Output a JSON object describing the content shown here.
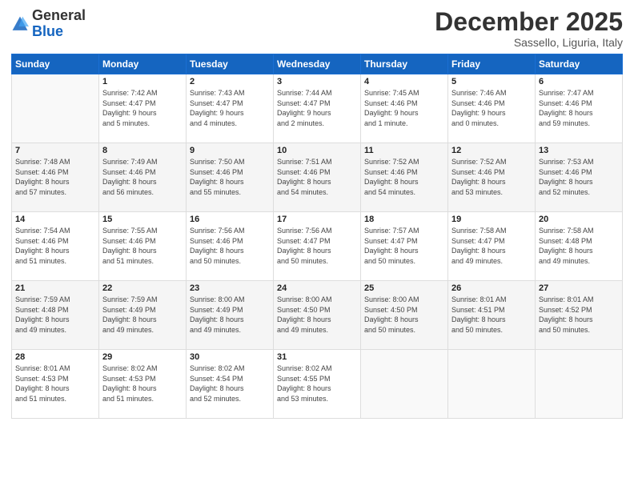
{
  "header": {
    "logo_general": "General",
    "logo_blue": "Blue",
    "month_title": "December 2025",
    "location": "Sassello, Liguria, Italy"
  },
  "weekdays": [
    "Sunday",
    "Monday",
    "Tuesday",
    "Wednesday",
    "Thursday",
    "Friday",
    "Saturday"
  ],
  "weeks": [
    [
      {
        "day": "",
        "info": ""
      },
      {
        "day": "1",
        "info": "Sunrise: 7:42 AM\nSunset: 4:47 PM\nDaylight: 9 hours\nand 5 minutes."
      },
      {
        "day": "2",
        "info": "Sunrise: 7:43 AM\nSunset: 4:47 PM\nDaylight: 9 hours\nand 4 minutes."
      },
      {
        "day": "3",
        "info": "Sunrise: 7:44 AM\nSunset: 4:47 PM\nDaylight: 9 hours\nand 2 minutes."
      },
      {
        "day": "4",
        "info": "Sunrise: 7:45 AM\nSunset: 4:46 PM\nDaylight: 9 hours\nand 1 minute."
      },
      {
        "day": "5",
        "info": "Sunrise: 7:46 AM\nSunset: 4:46 PM\nDaylight: 9 hours\nand 0 minutes."
      },
      {
        "day": "6",
        "info": "Sunrise: 7:47 AM\nSunset: 4:46 PM\nDaylight: 8 hours\nand 59 minutes."
      }
    ],
    [
      {
        "day": "7",
        "info": "Sunrise: 7:48 AM\nSunset: 4:46 PM\nDaylight: 8 hours\nand 57 minutes."
      },
      {
        "day": "8",
        "info": "Sunrise: 7:49 AM\nSunset: 4:46 PM\nDaylight: 8 hours\nand 56 minutes."
      },
      {
        "day": "9",
        "info": "Sunrise: 7:50 AM\nSunset: 4:46 PM\nDaylight: 8 hours\nand 55 minutes."
      },
      {
        "day": "10",
        "info": "Sunrise: 7:51 AM\nSunset: 4:46 PM\nDaylight: 8 hours\nand 54 minutes."
      },
      {
        "day": "11",
        "info": "Sunrise: 7:52 AM\nSunset: 4:46 PM\nDaylight: 8 hours\nand 54 minutes."
      },
      {
        "day": "12",
        "info": "Sunrise: 7:52 AM\nSunset: 4:46 PM\nDaylight: 8 hours\nand 53 minutes."
      },
      {
        "day": "13",
        "info": "Sunrise: 7:53 AM\nSunset: 4:46 PM\nDaylight: 8 hours\nand 52 minutes."
      }
    ],
    [
      {
        "day": "14",
        "info": "Sunrise: 7:54 AM\nSunset: 4:46 PM\nDaylight: 8 hours\nand 51 minutes."
      },
      {
        "day": "15",
        "info": "Sunrise: 7:55 AM\nSunset: 4:46 PM\nDaylight: 8 hours\nand 51 minutes."
      },
      {
        "day": "16",
        "info": "Sunrise: 7:56 AM\nSunset: 4:46 PM\nDaylight: 8 hours\nand 50 minutes."
      },
      {
        "day": "17",
        "info": "Sunrise: 7:56 AM\nSunset: 4:47 PM\nDaylight: 8 hours\nand 50 minutes."
      },
      {
        "day": "18",
        "info": "Sunrise: 7:57 AM\nSunset: 4:47 PM\nDaylight: 8 hours\nand 50 minutes."
      },
      {
        "day": "19",
        "info": "Sunrise: 7:58 AM\nSunset: 4:47 PM\nDaylight: 8 hours\nand 49 minutes."
      },
      {
        "day": "20",
        "info": "Sunrise: 7:58 AM\nSunset: 4:48 PM\nDaylight: 8 hours\nand 49 minutes."
      }
    ],
    [
      {
        "day": "21",
        "info": "Sunrise: 7:59 AM\nSunset: 4:48 PM\nDaylight: 8 hours\nand 49 minutes."
      },
      {
        "day": "22",
        "info": "Sunrise: 7:59 AM\nSunset: 4:49 PM\nDaylight: 8 hours\nand 49 minutes."
      },
      {
        "day": "23",
        "info": "Sunrise: 8:00 AM\nSunset: 4:49 PM\nDaylight: 8 hours\nand 49 minutes."
      },
      {
        "day": "24",
        "info": "Sunrise: 8:00 AM\nSunset: 4:50 PM\nDaylight: 8 hours\nand 49 minutes."
      },
      {
        "day": "25",
        "info": "Sunrise: 8:00 AM\nSunset: 4:50 PM\nDaylight: 8 hours\nand 50 minutes."
      },
      {
        "day": "26",
        "info": "Sunrise: 8:01 AM\nSunset: 4:51 PM\nDaylight: 8 hours\nand 50 minutes."
      },
      {
        "day": "27",
        "info": "Sunrise: 8:01 AM\nSunset: 4:52 PM\nDaylight: 8 hours\nand 50 minutes."
      }
    ],
    [
      {
        "day": "28",
        "info": "Sunrise: 8:01 AM\nSunset: 4:53 PM\nDaylight: 8 hours\nand 51 minutes."
      },
      {
        "day": "29",
        "info": "Sunrise: 8:02 AM\nSunset: 4:53 PM\nDaylight: 8 hours\nand 51 minutes."
      },
      {
        "day": "30",
        "info": "Sunrise: 8:02 AM\nSunset: 4:54 PM\nDaylight: 8 hours\nand 52 minutes."
      },
      {
        "day": "31",
        "info": "Sunrise: 8:02 AM\nSunset: 4:55 PM\nDaylight: 8 hours\nand 53 minutes."
      },
      {
        "day": "",
        "info": ""
      },
      {
        "day": "",
        "info": ""
      },
      {
        "day": "",
        "info": ""
      }
    ]
  ]
}
